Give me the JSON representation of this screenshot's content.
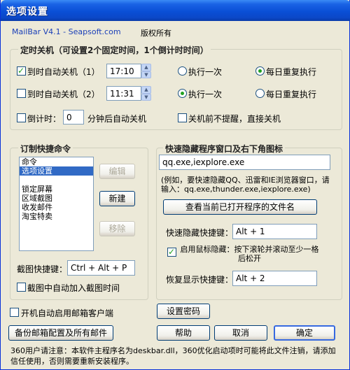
{
  "window": {
    "title": "选项设置"
  },
  "header": {
    "product": "MailBar V4.1 - Seapsoft.com",
    "copyright": "版权所有"
  },
  "shutdown": {
    "legend": "定时关机（可设置2个固定时间，1个倒计时时间）",
    "timer1": {
      "label": "到时自动关机（1）",
      "checked": true,
      "time": "17:10",
      "once_label": "执行一次",
      "daily_label": "每日重复执行",
      "mode": "daily"
    },
    "timer2": {
      "label": "到时自动关机（2）",
      "checked": false,
      "time": "11:31",
      "once_label": "执行一次",
      "daily_label": "每日重复执行",
      "mode": "once"
    },
    "countdown": {
      "label": "倒计时：",
      "value": "0",
      "suffix": "分钟后自动关机",
      "checked": false
    },
    "no_prompt": {
      "label": "关机前不提醒，直接关机",
      "checked": false
    }
  },
  "quick_commands": {
    "legend": "订制快捷命令",
    "items": [
      "命令",
      "选项设置",
      "",
      "锁定屏幕",
      "区域截图",
      "收发邮件",
      "淘宝特卖"
    ],
    "selected_index": 1,
    "edit_label": "编辑",
    "new_label": "新建",
    "remove_label": "移除",
    "screenshot_hotkey_label": "截图快捷键：",
    "screenshot_hotkey": "Ctrl + Alt + P",
    "add_time": {
      "label": "截图中自动加入截图时间",
      "checked": false
    }
  },
  "hide_windows": {
    "legend": "快速隐藏程序窗口及右下角图标",
    "programs": "qq.exe,iexplore.exe",
    "hint": "(例如，要快速隐藏QQ、迅雷和IE浏览器窗口，请输入：qq.exe,thunder.exe,iexplore.exe)",
    "view_button": "查看当前已打开程序的文件名",
    "hide_hotkey_label": "快速隐藏快捷键：",
    "hide_hotkey": "Alt + 1",
    "mouse_hide": {
      "label": "启用鼠标隐藏：按下滚轮并滚动至少一格后松开",
      "checked": true
    },
    "restore_hotkey_label": "恢复显示快捷键：",
    "restore_hotkey": "Alt + 2"
  },
  "footer": {
    "autostart": {
      "label": "开机自动启用邮箱客户端",
      "checked": false
    },
    "set_password": "设置密码",
    "backup": "备份邮箱配置及所有邮件",
    "help": "帮助",
    "cancel": "取消",
    "ok": "确定",
    "note": "360用户请注意：本软件主程序名为deskbar.dll，360优化启动项时可能将此文件注销，请添加信任使用，否则需要重新安装程序。"
  }
}
